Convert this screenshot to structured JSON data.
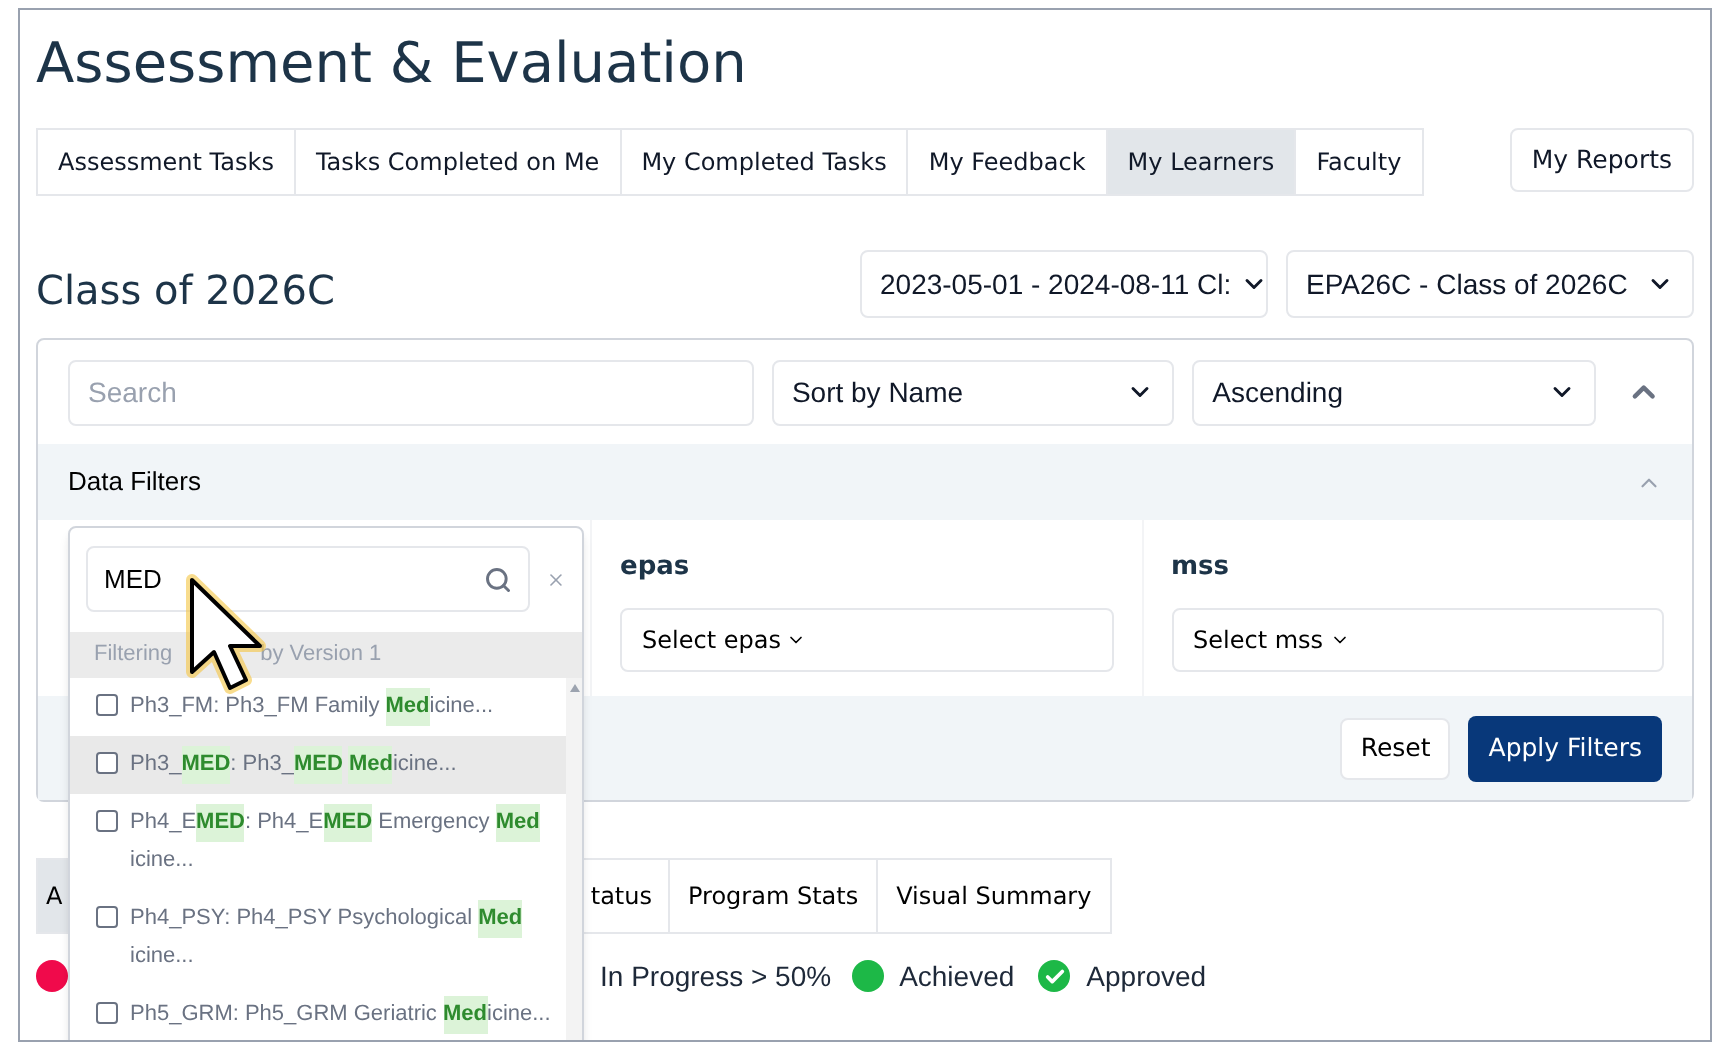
{
  "page_title": "Assessment & Evaluation",
  "tabs": [
    {
      "label": "Assessment Tasks",
      "selected": false
    },
    {
      "label": "Tasks Completed on Me",
      "selected": false
    },
    {
      "label": "My Completed Tasks",
      "selected": false
    },
    {
      "label": "My Feedback",
      "selected": false
    },
    {
      "label": "My Learners",
      "selected": true
    },
    {
      "label": "Faculty",
      "selected": false
    }
  ],
  "reports_button": "My Reports",
  "section_title": "Class of 2026C",
  "period_select": "2023-05-01 - 2024-08-11 Cl:",
  "cohort_select": "EPA26C - Class of 2026C",
  "search": {
    "placeholder": "Search"
  },
  "sort_select": "Sort by Name",
  "order_select": "Ascending",
  "data_filters": {
    "title": "Data Filters",
    "expanded": true
  },
  "filters": [
    {
      "label": "epas",
      "placeholder": "Select epas"
    },
    {
      "label": "mss",
      "placeholder": "Select mss"
    }
  ],
  "reset_button": "Reset",
  "apply_button": "Apply Filters",
  "view_tabs": [
    {
      "label": "A",
      "selected": true
    },
    {
      "label": "tatus",
      "selected": false
    },
    {
      "label": "Program Stats",
      "selected": false
    },
    {
      "label": "Visual Summary",
      "selected": false
    }
  ],
  "legend": [
    {
      "kind": "dot",
      "color": "#f00a4b"
    },
    {
      "kind": "text",
      "label": "In Progress > 50%"
    },
    {
      "kind": "dot",
      "color": "#1db847",
      "label": "Achieved"
    },
    {
      "kind": "check",
      "color": "#1db847",
      "label": "Approved"
    }
  ],
  "dropdown": {
    "value": "MED",
    "header": [
      "Filtering",
      "by Version 1"
    ],
    "items": [
      {
        "checked": false,
        "highlighted": false,
        "label": "Ph3_FM: Ph3_FM Family **Med**icine..."
      },
      {
        "checked": false,
        "highlighted": true,
        "label": "Ph3_**MED**: Ph3_**MED** **Med**icine..."
      },
      {
        "checked": false,
        "highlighted": false,
        "label": "Ph4_E**MED**: Ph4_E**MED** Emergency **Med**icine..."
      },
      {
        "checked": false,
        "highlighted": false,
        "label": "Ph4_PSY: Ph4_PSY Psychological **Med**icine..."
      },
      {
        "checked": false,
        "highlighted": false,
        "label": "Ph5_GRM: Ph5_GRM Geriatric **Med**icine..."
      }
    ]
  }
}
